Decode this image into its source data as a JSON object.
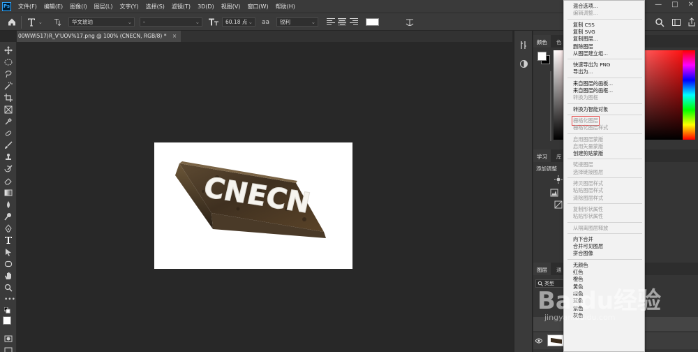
{
  "app": {
    "logo": "Ps"
  },
  "menubar": {
    "items": [
      "文件(F)",
      "编辑(E)",
      "图像(I)",
      "图层(L)",
      "文字(Y)",
      "选择(S)",
      "滤镜(T)",
      "3D(D)",
      "视图(V)",
      "窗口(W)",
      "帮助(H)"
    ],
    "window_controls": [
      "—",
      "□",
      "✕"
    ]
  },
  "options_bar": {
    "font_family": "华文琥珀",
    "font_style": "-",
    "font_size": "60.18 点",
    "aa_label": "aa",
    "antialias": "锐利",
    "text_color": "#ffffff"
  },
  "document": {
    "tab_title": "00WWI517)R_V'UOV%17.png @ 100% (CNECN, RGB/8) *",
    "close_label": "×",
    "canvas_text": "CNECN"
  },
  "panels": {
    "color_tabs": [
      "颜色",
      "色"
    ],
    "learn_tabs": [
      "学习",
      "库"
    ],
    "adjustments_title": "添加调整",
    "layers_tabs": [
      "图层",
      "通"
    ],
    "layers_filter": "类型"
  },
  "context_menu": {
    "groups": [
      [
        {
          "label": "混合选项...",
          "disabled": false
        },
        {
          "label": "编辑调整...",
          "disabled": true
        }
      ],
      [
        {
          "label": "复制 CSS",
          "disabled": false
        },
        {
          "label": "复制 SVG",
          "disabled": false
        },
        {
          "label": "复制图层...",
          "disabled": false
        },
        {
          "label": "删除图层",
          "disabled": false
        },
        {
          "label": "从图层建立组...",
          "disabled": false
        }
      ],
      [
        {
          "label": "快速导出为 PNG",
          "disabled": false
        },
        {
          "label": "导出为...",
          "disabled": false
        }
      ],
      [
        {
          "label": "来自图层的画板...",
          "disabled": false
        },
        {
          "label": "来自图层的画框...",
          "disabled": false
        },
        {
          "label": "转换为图框",
          "disabled": true
        }
      ],
      [
        {
          "label": "转换为智能对象",
          "disabled": false
        }
      ],
      [
        {
          "label": "栅格化图层",
          "disabled": true,
          "highlighted": true
        },
        {
          "label": "栅格化图层样式",
          "disabled": true
        }
      ],
      [
        {
          "label": "启用图层蒙版",
          "disabled": true
        },
        {
          "label": "启用矢量蒙版",
          "disabled": true
        },
        {
          "label": "创建剪贴蒙版",
          "disabled": false
        }
      ],
      [
        {
          "label": "链接图层",
          "disabled": true
        },
        {
          "label": "选择链接图层",
          "disabled": true
        }
      ],
      [
        {
          "label": "拷贝图层样式",
          "disabled": true
        },
        {
          "label": "粘贴图层样式",
          "disabled": true
        },
        {
          "label": "清除图层样式",
          "disabled": true
        }
      ],
      [
        {
          "label": "复制形状属性",
          "disabled": true
        },
        {
          "label": "粘贴形状属性",
          "disabled": true
        }
      ],
      [
        {
          "label": "从隔离图层释放",
          "disabled": true
        }
      ],
      [
        {
          "label": "向下合并",
          "disabled": false
        },
        {
          "label": "合并可见图层",
          "disabled": false
        },
        {
          "label": "拼合图像",
          "disabled": false
        }
      ],
      [
        {
          "label": "无颜色",
          "disabled": false
        },
        {
          "label": "红色",
          "disabled": false
        },
        {
          "label": "橙色",
          "disabled": false
        },
        {
          "label": "黄色",
          "disabled": false
        },
        {
          "label": "绿色",
          "disabled": false
        },
        {
          "label": "蓝色",
          "disabled": false
        },
        {
          "label": "紫色",
          "disabled": false
        },
        {
          "label": "灰色",
          "disabled": false
        }
      ]
    ]
  },
  "watermark": {
    "brand": "Baidu经验",
    "url": "jingyan.baidu.com"
  }
}
